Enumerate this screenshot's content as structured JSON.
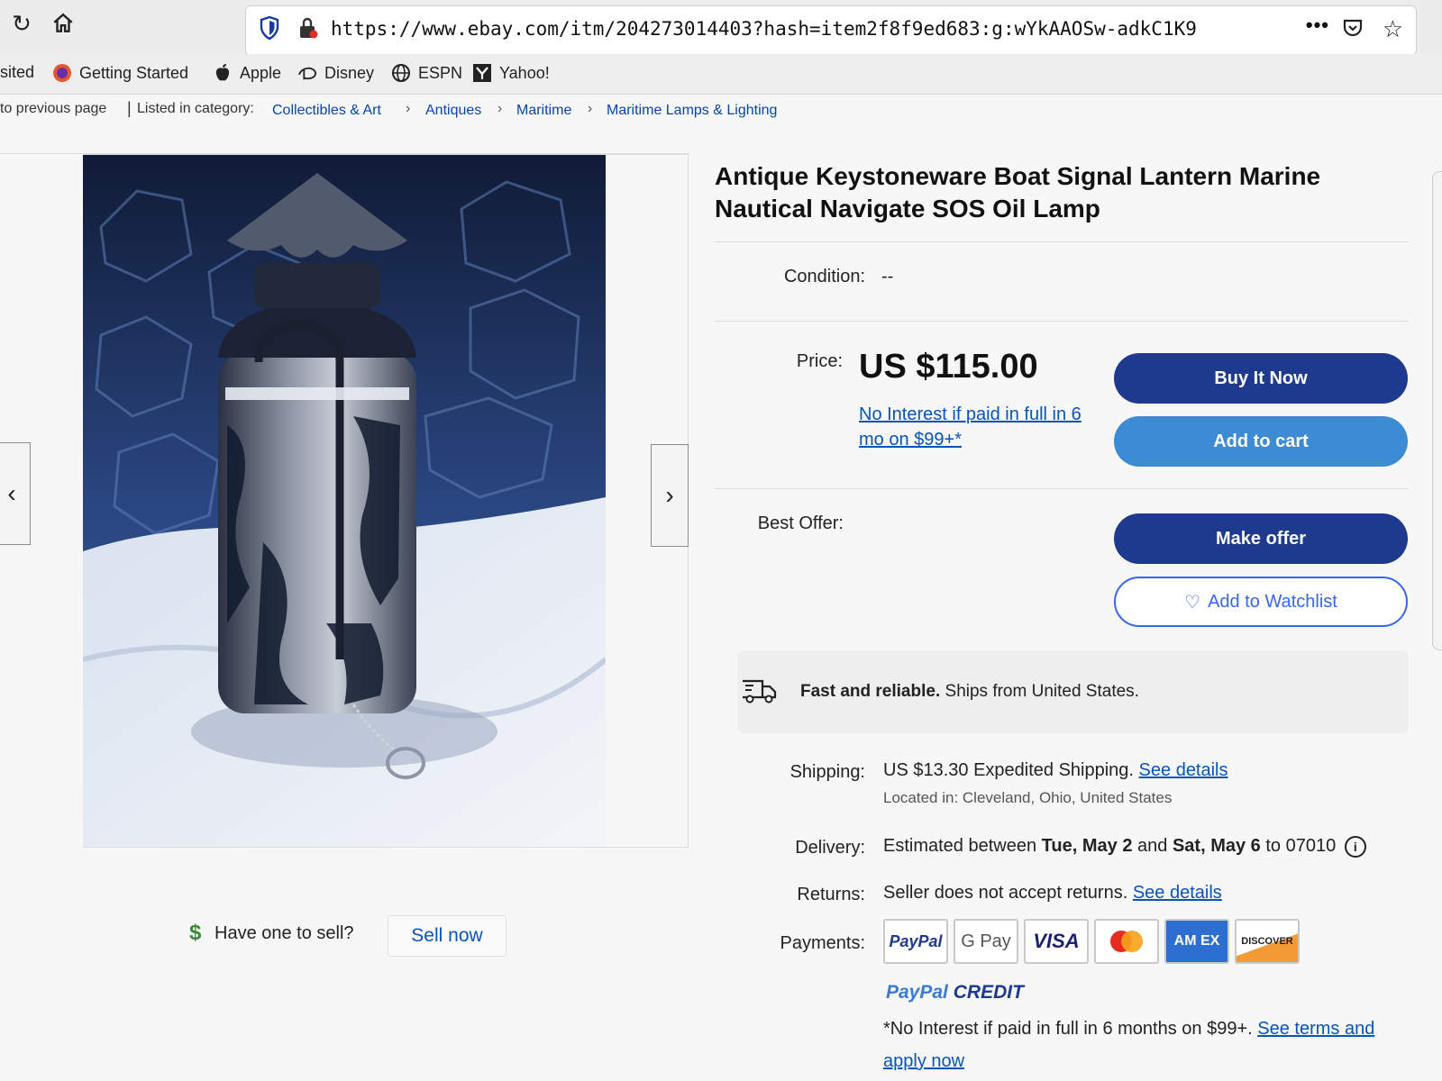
{
  "browser": {
    "url": "https://www.ebay.com/itm/204273014403?hash=item2f8f9ed683:g:wYkAAOSw-adkC1K9",
    "more_label": "•••",
    "bookmarks": [
      {
        "label": "sited",
        "icon": "none"
      },
      {
        "label": "Getting Started",
        "icon": "firefox-icon"
      },
      {
        "label": "Apple",
        "icon": "apple-icon"
      },
      {
        "label": "Disney",
        "icon": "disney-icon"
      },
      {
        "label": "ESPN",
        "icon": "globe-icon"
      },
      {
        "label": "Yahoo!",
        "icon": "yahoo-icon"
      }
    ]
  },
  "breadcrumb": {
    "back": "to previous page",
    "separator": "|",
    "listed_in": "Listed in category:",
    "categories": [
      "Collectibles & Art",
      "Antiques",
      "Maritime",
      "Maritime Lamps & Lighting"
    ]
  },
  "listing": {
    "title": "Antique Keystoneware Boat Signal Lantern Marine Nautical Navigate SOS Oil Lamp",
    "condition_label": "Condition:",
    "condition_value": "--",
    "price_label": "Price:",
    "price": "US $115.00",
    "financing": "No Interest if paid in full in 6 mo on $99+*",
    "best_offer_label": "Best Offer:",
    "buttons": {
      "buy_now": "Buy It Now",
      "add_to_cart": "Add to cart",
      "make_offer": "Make offer",
      "watchlist": "Add to Watchlist"
    }
  },
  "shipping_banner": {
    "bold": "Fast and reliable.",
    "text": "Ships from United States."
  },
  "details": {
    "shipping_label": "Shipping:",
    "shipping_value": "US $13.30 Expedited Shipping.",
    "shipping_link": "See details",
    "location": "Located in: Cleveland, Ohio, United States",
    "delivery_label": "Delivery:",
    "delivery_prefix": "Estimated between",
    "delivery_start": "Tue, May 2",
    "delivery_and": "and",
    "delivery_end": "Sat, May 6",
    "delivery_suffix": "to 07010",
    "returns_label": "Returns:",
    "returns_value": "Seller does not accept returns.",
    "returns_link": "See details",
    "payments_label": "Payments:",
    "payment_methods": [
      "PayPal",
      "G Pay",
      "VISA",
      "Mastercard",
      "AM EX",
      "DISCOVER"
    ],
    "paypal_credit_a": "PayPal",
    "paypal_credit_b": "CREDIT",
    "credit_note": "*No Interest if paid in full in 6 months on $99+.",
    "credit_link": "See terms and apply now"
  },
  "sell": {
    "question": "Have one to sell?",
    "link": "Sell now"
  },
  "colors": {
    "link": "#0654ba",
    "buy_now_bg": "#1d3a8f",
    "add_to_cart_bg": "#3d8bd4",
    "outline": "#3665f3"
  }
}
